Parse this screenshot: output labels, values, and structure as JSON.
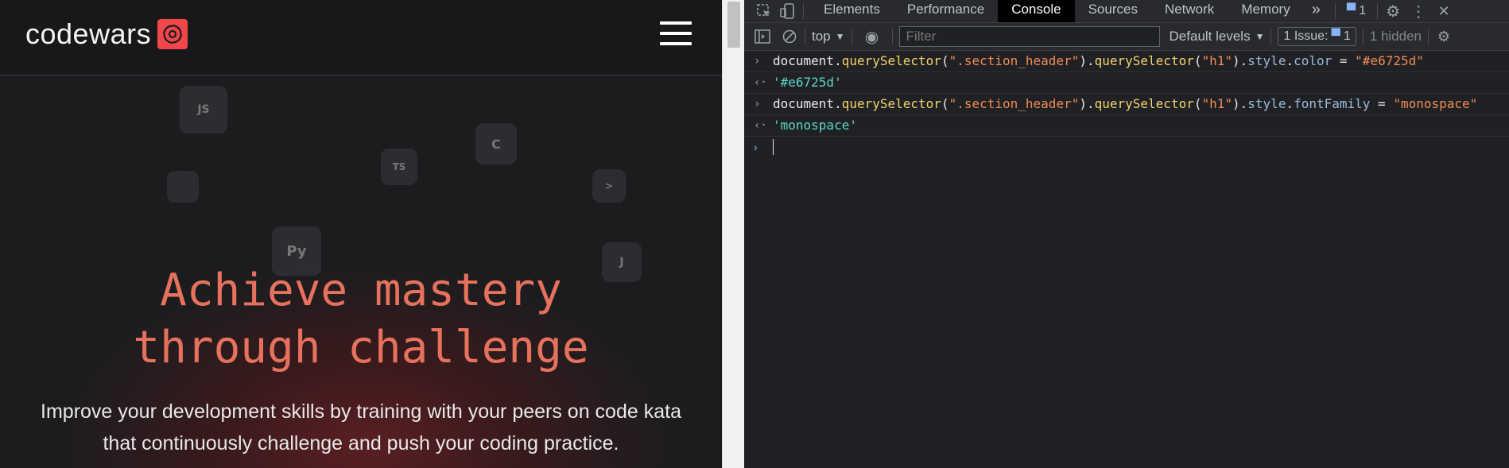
{
  "site": {
    "logo_text": "codewars",
    "hero_title_line1": "Achieve mastery",
    "hero_title_line2": "through challenge",
    "hero_subtitle_line1": "Improve your development skills by training with your peers on code kata",
    "hero_subtitle_line2": "that continuously challenge and push your coding practice.",
    "hero_title_color": "#e6725d",
    "bg_icons": [
      "js-icon",
      "typescript-icon",
      "csharp-icon",
      "terminal-icon",
      "python-icon",
      "java-icon"
    ]
  },
  "devtools": {
    "tabs": [
      "Elements",
      "Performance",
      "Console",
      "Sources",
      "Network",
      "Memory"
    ],
    "active_tab": "Console",
    "more_tabs": "»",
    "message_count": "1",
    "context": "top",
    "filter_placeholder": "Filter",
    "levels": "Default levels",
    "issues_label": "1 Issue:",
    "issues_count": "1",
    "hidden_label": "1 hidden",
    "console": [
      {
        "type": "input",
        "parts": [
          {
            "t": "document",
            "c": "c-obj"
          },
          {
            "t": ".",
            "c": "c-pn"
          },
          {
            "t": "querySelector",
            "c": "c-fn"
          },
          {
            "t": "(",
            "c": "c-pn"
          },
          {
            "t": "\".section_header\"",
            "c": "c-str"
          },
          {
            "t": ").",
            "c": "c-pn"
          },
          {
            "t": "querySelector",
            "c": "c-fn"
          },
          {
            "t": "(",
            "c": "c-pn"
          },
          {
            "t": "\"h1\"",
            "c": "c-str"
          },
          {
            "t": ").",
            "c": "c-pn"
          },
          {
            "t": "style",
            "c": "c-prop"
          },
          {
            "t": ".",
            "c": "c-pn"
          },
          {
            "t": "color",
            "c": "c-prop"
          },
          {
            "t": " = ",
            "c": "c-pn"
          },
          {
            "t": "\"#e6725d\"",
            "c": "c-str"
          }
        ]
      },
      {
        "type": "result",
        "parts": [
          {
            "t": "'#e6725d'",
            "c": "c-ret"
          }
        ]
      },
      {
        "type": "input",
        "parts": [
          {
            "t": "document",
            "c": "c-obj"
          },
          {
            "t": ".",
            "c": "c-pn"
          },
          {
            "t": "querySelector",
            "c": "c-fn"
          },
          {
            "t": "(",
            "c": "c-pn"
          },
          {
            "t": "\".section_header\"",
            "c": "c-str"
          },
          {
            "t": ").",
            "c": "c-pn"
          },
          {
            "t": "querySelector",
            "c": "c-fn"
          },
          {
            "t": "(",
            "c": "c-pn"
          },
          {
            "t": "\"h1\"",
            "c": "c-str"
          },
          {
            "t": ").",
            "c": "c-pn"
          },
          {
            "t": "style",
            "c": "c-prop"
          },
          {
            "t": ".",
            "c": "c-pn"
          },
          {
            "t": "fontFamily",
            "c": "c-prop"
          },
          {
            "t": " = ",
            "c": "c-pn"
          },
          {
            "t": "\"monospace\"",
            "c": "c-str"
          }
        ]
      },
      {
        "type": "result",
        "parts": [
          {
            "t": "'monospace'",
            "c": "c-ret"
          }
        ]
      }
    ]
  }
}
